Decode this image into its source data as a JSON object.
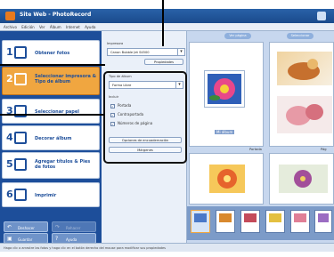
{
  "window": {
    "title": "Site Web - PhotoRecord"
  },
  "menu": [
    "Archivo",
    "Edición",
    "Ver",
    "Álbum",
    "Internet",
    "Ayuda"
  ],
  "steps": [
    {
      "num": "1",
      "label": "Obtener fotos"
    },
    {
      "num": "2",
      "label": "Seleccionar impresora & Tipo de álbum"
    },
    {
      "num": "3",
      "label": "Seleccionar papel"
    },
    {
      "num": "4",
      "label": "Decorar álbum"
    },
    {
      "num": "5",
      "label": "Agregar títulos & Pies de fotos"
    },
    {
      "num": "6",
      "label": "Imprimir"
    }
  ],
  "sidebar_buttons": {
    "undo": "Deshacer",
    "redo": "Rehacer",
    "save": "Guardar",
    "help": "Ayuda"
  },
  "printer": {
    "label": "Impresora",
    "value": "Canon Bubble Jet S4500",
    "properties": "Propiedades"
  },
  "album": {
    "type_label": "Tipo de álbum",
    "type_value": "Forma Libre",
    "include_label": "Incluir",
    "options": [
      "Portada",
      "Contraportada",
      "Números de página"
    ],
    "layout_options_btn": "Opciones de encuadernación",
    "margins_btn": "Márgenes"
  },
  "canvas": {
    "toolbar": [
      "Ver página",
      "Seleccionar"
    ],
    "album_title": "Mi álbum",
    "cover_label": "Portada",
    "page_label": "Pág"
  },
  "status": "Haga clic o arrastre las fotos y haga clic en el botón derecho del mouse para modificar sus propiedades",
  "colors": {
    "accent": "#f0a640",
    "brand": "#1d4e9a",
    "canvas": "#c7d7ee"
  }
}
